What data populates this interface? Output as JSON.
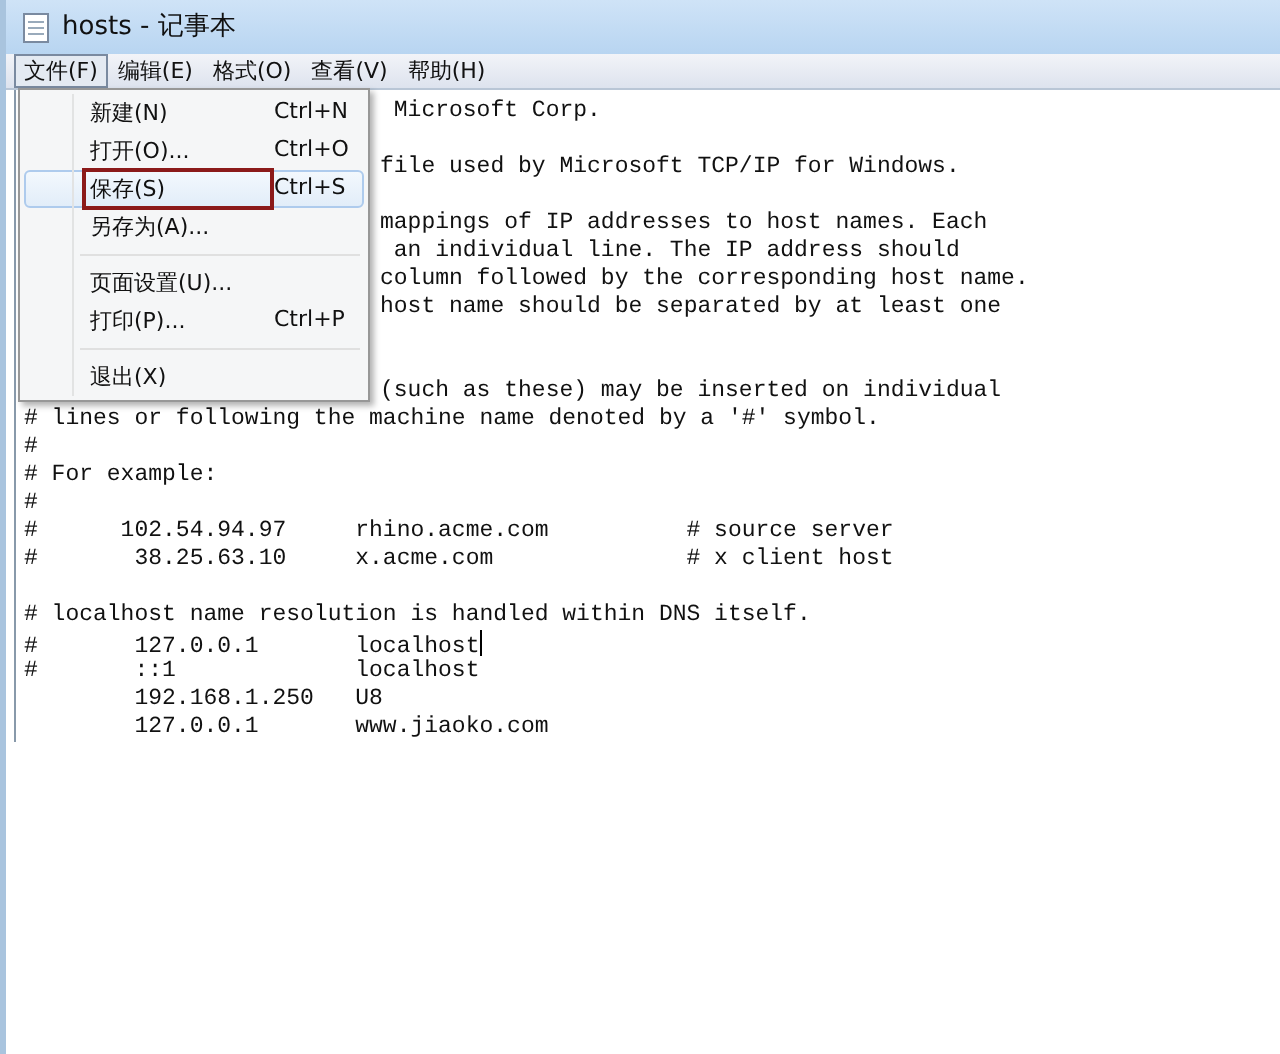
{
  "window": {
    "title": "hosts - 记事本"
  },
  "menubar": [
    {
      "label": "文件(F)",
      "selected": true
    },
    {
      "label": "编辑(E)",
      "selected": false
    },
    {
      "label": "格式(O)",
      "selected": false
    },
    {
      "label": "查看(V)",
      "selected": false
    },
    {
      "label": "帮助(H)",
      "selected": false
    }
  ],
  "file_menu": [
    {
      "kind": "item",
      "label": "新建(N)",
      "shortcut": "Ctrl+N",
      "highlighted": false,
      "annotated": false
    },
    {
      "kind": "item",
      "label": "打开(O)...",
      "shortcut": "Ctrl+O",
      "highlighted": false,
      "annotated": false
    },
    {
      "kind": "item",
      "label": "保存(S)",
      "shortcut": "Ctrl+S",
      "highlighted": true,
      "annotated": true
    },
    {
      "kind": "item",
      "label": "另存为(A)...",
      "highlighted": false,
      "annotated": false
    },
    {
      "kind": "separator"
    },
    {
      "kind": "item",
      "label": "页面设置(U)...",
      "highlighted": false,
      "annotated": false
    },
    {
      "kind": "item",
      "label": "打印(P)...",
      "shortcut": "Ctrl+P",
      "highlighted": false,
      "annotated": false
    },
    {
      "kind": "separator"
    },
    {
      "kind": "item",
      "label": "退出(X)",
      "highlighted": false,
      "annotated": false
    }
  ],
  "editor": {
    "lines": [
      {
        "kind": "partial",
        "text": " Microsoft Corp."
      },
      {
        "kind": "hidden"
      },
      {
        "kind": "partial",
        "text": "file used by Microsoft TCP/IP for Windows."
      },
      {
        "kind": "hidden"
      },
      {
        "kind": "partial",
        "text": "mappings of IP addresses to host names. Each"
      },
      {
        "kind": "partial",
        "text": " an individual line. The IP address should"
      },
      {
        "kind": "partial",
        "text": "column followed by the corresponding host name."
      },
      {
        "kind": "partial",
        "text": "host name should be separated by at least one"
      },
      {
        "kind": "hidden"
      },
      {
        "kind": "hidden"
      },
      {
        "kind": "partial",
        "text": "(such as these) may be inserted on individual"
      },
      {
        "kind": "full",
        "text": "# lines or following the machine name denoted by a '#' symbol."
      },
      {
        "kind": "full",
        "text": "#"
      },
      {
        "kind": "full",
        "text": "# For example:"
      },
      {
        "kind": "full",
        "text": "#"
      },
      {
        "kind": "full",
        "text": "#      102.54.94.97     rhino.acme.com          # source server"
      },
      {
        "kind": "full",
        "text": "#       38.25.63.10     x.acme.com              # x client host"
      },
      {
        "kind": "blank"
      },
      {
        "kind": "full",
        "text": "# localhost name resolution is handled within DNS itself."
      },
      {
        "kind": "full",
        "text": "#       127.0.0.1       localhost",
        "caret": true
      },
      {
        "kind": "full",
        "text": "#       ::1             localhost",
        "caret": false
      },
      {
        "kind": "full",
        "text": "        192.168.1.250   U8"
      },
      {
        "kind": "full",
        "text": "        127.0.0.1       www.jiaoko.com"
      }
    ]
  }
}
